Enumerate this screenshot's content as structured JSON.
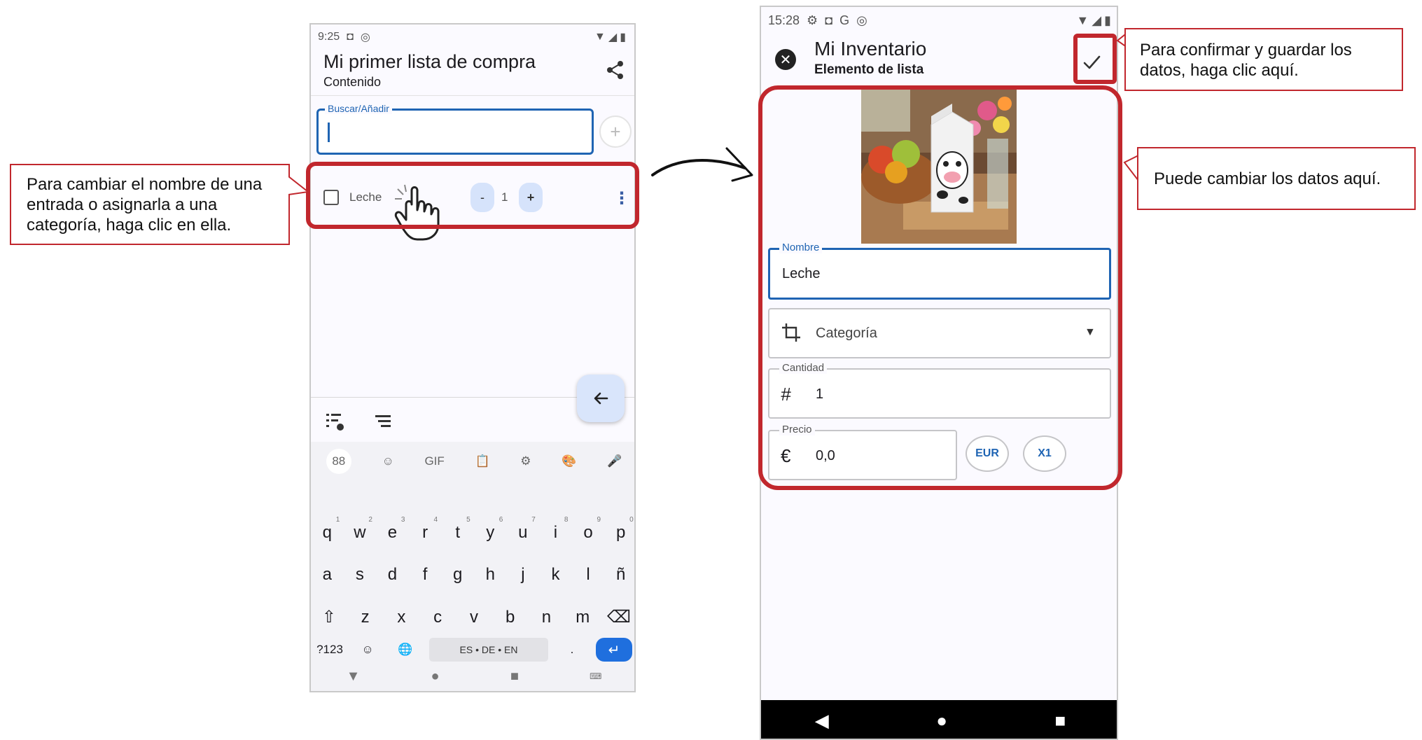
{
  "phone1": {
    "status_time": "9:25",
    "title": "Mi primer lista de compra",
    "subtitle": "Contenido",
    "search_label": "Buscar/Añadir",
    "item": {
      "label": "Leche",
      "minus": "-",
      "quantity": "1",
      "plus": "+"
    },
    "keyboard": {
      "top_row": [
        "88",
        "☺",
        "GIF",
        "📋",
        "⚙",
        "🎨",
        "🎤"
      ],
      "row1": [
        "q",
        "w",
        "e",
        "r",
        "t",
        "y",
        "u",
        "i",
        "o",
        "p"
      ],
      "row1_hints": [
        "1",
        "2",
        "3",
        "4",
        "5",
        "6",
        "7",
        "8",
        "9",
        "0"
      ],
      "row2": [
        "a",
        "s",
        "d",
        "f",
        "g",
        "h",
        "j",
        "k",
        "l",
        "ñ"
      ],
      "row3": [
        "z",
        "x",
        "c",
        "v",
        "b",
        "n",
        "m"
      ],
      "symbols_key": "?123",
      "emoji_key": "☺",
      "space_label": "ES • DE • EN",
      "period_key": "."
    }
  },
  "phone2": {
    "status_time": "15:28",
    "title": "Mi Inventario",
    "subtitle": "Elemento de lista",
    "name_label": "Nombre",
    "name_value": "Leche",
    "category_placeholder": "Categoría",
    "quantity_label": "Cantidad",
    "quantity_value": "1",
    "price_label": "Precio",
    "price_value": "0,0",
    "currency_symbol": "€",
    "currency_button": "EUR",
    "multiplier_button": "X1",
    "hash_symbol": "#"
  },
  "callouts": {
    "rename": "Para cambiar el nombre de una entrada o asignarla a una categoría, haga clic en ella.",
    "confirm": "Para confirmar y guardar los datos, haga clic aquí.",
    "edit": "Puede cambiar los datos aquí."
  },
  "colors": {
    "highlight": "#c1272d",
    "accent": "#1f64b3",
    "chip_bg": "#d6e3fb"
  },
  "icons": [
    "share-icon",
    "add-icon",
    "checkbox-icon",
    "more-vert-icon",
    "back-arrow-icon",
    "close-icon",
    "check-icon",
    "crop-icon",
    "dropdown-icon",
    "hand-pointer-icon"
  ]
}
